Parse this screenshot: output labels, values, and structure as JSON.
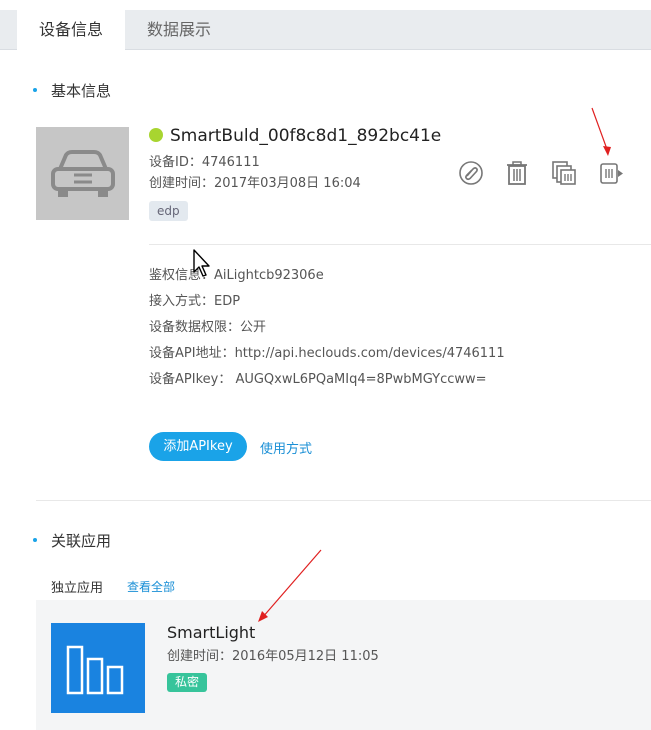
{
  "tabs": [
    {
      "label": "设备信息",
      "active": true
    },
    {
      "label": "数据展示",
      "active": false
    }
  ],
  "basic_info": {
    "section_title": "基本信息",
    "device": {
      "name": "SmartBuld_00f8c8d1_892bc41e",
      "id_line": "设备ID：4746111",
      "created_line": "创建时间：2017年03月08日 16:04",
      "tag": "edp",
      "status_color": "#a8d530"
    },
    "tools": [
      {
        "icon": "paperclip-icon"
      },
      {
        "icon": "trash-icon"
      },
      {
        "icon": "copy-icon"
      },
      {
        "icon": "export-icon"
      }
    ],
    "details": [
      "鉴权信息：AiLightcb92306e",
      "接入方式：EDP",
      "设备数据权限：公开",
      "设备API地址：http://api.heclouds.com/devices/4746111",
      "设备APIkey： AUGQxwL6PQaMIq4=8PwbMGYccww="
    ],
    "add_apikey_label": "添加APIkey",
    "usage_link": "使用方式"
  },
  "related_apps": {
    "section_title": "关联应用",
    "sub_label": "独立应用",
    "view_all": "查看全部",
    "apps": [
      {
        "name": "SmartLight",
        "created_line": "创建时间：2016年05月12日 11:05",
        "badge": "私密"
      }
    ]
  },
  "colors": {
    "accent": "#1aa3e8",
    "link": "#1a8fd6",
    "badge_private": "#37c49b",
    "app_thumb": "#1a83e0",
    "annotation_arrow": "#e02020"
  }
}
